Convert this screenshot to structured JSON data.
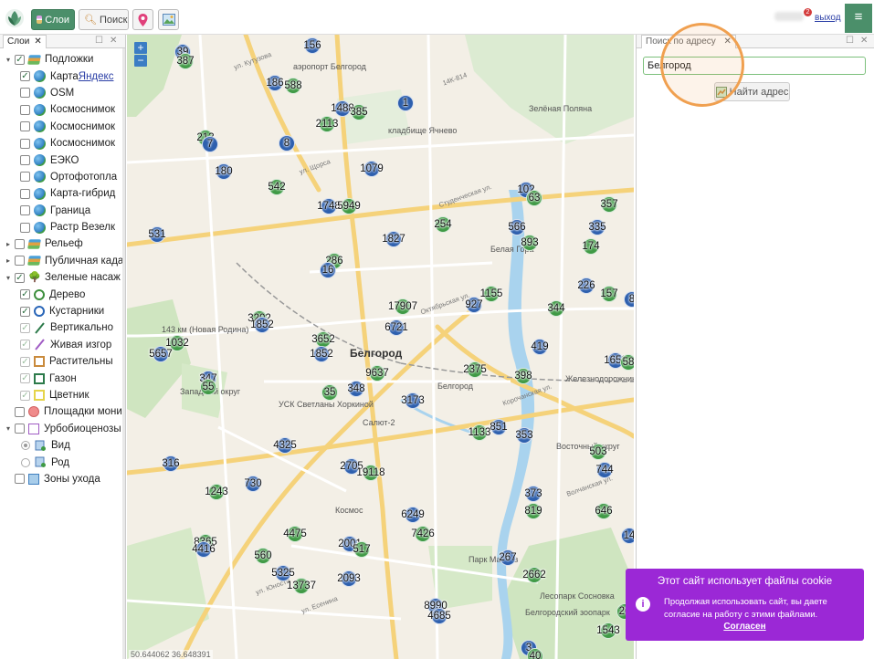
{
  "toolbar": {
    "layers_label": "Слои",
    "search_label": "Поиск",
    "notification_count": "2",
    "logout_label": "выход",
    "menu_glyph": "≡"
  },
  "left_panel": {
    "tab_label": "Слои",
    "tree": [
      {
        "label": "Подложки",
        "level": 0,
        "expander": "▾",
        "check": "checked",
        "icon": "stack"
      },
      {
        "label": "Карта ",
        "link": "Яндекс",
        "level": 1,
        "check": "checked",
        "icon": "globe"
      },
      {
        "label": "OSM",
        "level": 1,
        "check": "unchecked",
        "icon": "globe"
      },
      {
        "label": "Космоснимок",
        "level": 1,
        "check": "unchecked",
        "icon": "globe"
      },
      {
        "label": "Космоснимок",
        "level": 1,
        "check": "unchecked",
        "icon": "globe"
      },
      {
        "label": "Космоснимок",
        "level": 1,
        "check": "unchecked",
        "icon": "globe"
      },
      {
        "label": "ЕЭКО",
        "level": 1,
        "check": "unchecked",
        "icon": "globe"
      },
      {
        "label": "Ортофотопла",
        "level": 1,
        "check": "unchecked",
        "icon": "globe"
      },
      {
        "label": "Карта-гибрид",
        "level": 1,
        "check": "unchecked",
        "icon": "globe"
      },
      {
        "label": "Граница",
        "level": 1,
        "check": "unchecked",
        "icon": "globe"
      },
      {
        "label": "Растр Везелк",
        "level": 1,
        "check": "unchecked",
        "icon": "globe"
      },
      {
        "label": "Рельеф",
        "level": 0,
        "expander": "▸",
        "check": "unchecked",
        "icon": "stack"
      },
      {
        "label": "Публичная када",
        "level": 0,
        "expander": "▸",
        "check": "unchecked",
        "icon": "stack"
      },
      {
        "label": "Зеленые насаж",
        "level": 0,
        "expander": "▾",
        "check": "checked",
        "icon": "tree"
      },
      {
        "label": "Дерево",
        "level": 1,
        "check": "checked",
        "icon": "circ-g"
      },
      {
        "label": "Кустарники",
        "level": 1,
        "check": "checked",
        "icon": "circ-b"
      },
      {
        "label": "Вертикально",
        "level": 1,
        "check": "dim",
        "icon": "line-g"
      },
      {
        "label": "Живая изгор",
        "level": 1,
        "check": "dim",
        "icon": "line-p"
      },
      {
        "label": "Растительны",
        "level": 1,
        "check": "dim",
        "icon": "sq-o"
      },
      {
        "label": "Газон",
        "level": 1,
        "check": "dim",
        "icon": "sq-g"
      },
      {
        "label": "Цветник",
        "level": 1,
        "check": "dim",
        "icon": "sq-y"
      },
      {
        "label": "Площадки мони",
        "level": 0,
        "check": "unchecked",
        "icon": "dot-r"
      },
      {
        "label": "Урбобиоценозы",
        "level": 0,
        "expander": "▾",
        "check": "unchecked",
        "icon": "sq-p"
      },
      {
        "label": "Вид",
        "level": 1,
        "radio": "on",
        "icon": "doc"
      },
      {
        "label": "Род",
        "level": 1,
        "radio": "off",
        "icon": "doc"
      },
      {
        "label": "Зоны ухода",
        "level": 0,
        "check": "unchecked",
        "icon": "sq-b"
      }
    ]
  },
  "map": {
    "zoom_in": "+",
    "zoom_out": "−",
    "coordinates": "50.644062 36.648391",
    "labels": [
      {
        "text": "Белгород",
        "cls": "city"
      },
      {
        "text": "аэропорт Белгород"
      },
      {
        "text": "Зелёная Поляна"
      },
      {
        "text": "Белая Гора"
      },
      {
        "text": "кладбище Ячнево"
      },
      {
        "text": "143 км (Новая Родина)"
      },
      {
        "text": "Белгород"
      },
      {
        "text": "Салют-2"
      },
      {
        "text": "Космос"
      },
      {
        "text": "Восточный округ"
      },
      {
        "text": "Западный округ"
      },
      {
        "text": "Железнодорожник"
      },
      {
        "text": "ул. Щорса",
        "cls": "road"
      },
      {
        "text": "Октябрьская ул.",
        "cls": "road"
      },
      {
        "text": "Студенческая ул.",
        "cls": "road"
      },
      {
        "text": "Белгородский зоопарк"
      },
      {
        "text": "Лесопарк Сосновка"
      },
      {
        "text": "ул. Есенина",
        "cls": "road"
      },
      {
        "text": "ул. Юности",
        "cls": "road"
      },
      {
        "text": "ул. Кутузова",
        "cls": "road"
      },
      {
        "text": "Корочанская ул.",
        "cls": "road"
      },
      {
        "text": "Волчанская ул.",
        "cls": "road"
      },
      {
        "text": "УСК Светланы Хоркиной"
      },
      {
        "text": "Парк Массив"
      },
      {
        "text": "14К-814",
        "cls": "road"
      }
    ],
    "clusters": [
      {
        "n": "39",
        "c": "b"
      },
      {
        "n": "387",
        "c": "g"
      },
      {
        "n": "156",
        "c": "b"
      },
      {
        "n": "186",
        "c": "b"
      },
      {
        "n": "588",
        "c": "g"
      },
      {
        "n": "1",
        "c": "b"
      },
      {
        "n": "1488",
        "c": "b"
      },
      {
        "n": "385",
        "c": "g"
      },
      {
        "n": "2113",
        "c": "g"
      },
      {
        "n": "213",
        "c": "g"
      },
      {
        "n": "7",
        "c": "b"
      },
      {
        "n": "8",
        "c": "b"
      },
      {
        "n": "180",
        "c": "b"
      },
      {
        "n": "1079",
        "c": "b"
      },
      {
        "n": "542",
        "c": "g"
      },
      {
        "n": "102",
        "c": "b"
      },
      {
        "n": "63",
        "c": "g"
      },
      {
        "n": "357",
        "c": "g"
      },
      {
        "n": "1748",
        "c": "b"
      },
      {
        "n": "5949",
        "c": "g"
      },
      {
        "n": "254",
        "c": "g"
      },
      {
        "n": "566",
        "c": "b"
      },
      {
        "n": "335",
        "c": "b"
      },
      {
        "n": "531",
        "c": "b"
      },
      {
        "n": "1827",
        "c": "b"
      },
      {
        "n": "893",
        "c": "g"
      },
      {
        "n": "174",
        "c": "g"
      },
      {
        "n": "286",
        "c": "g"
      },
      {
        "n": "16",
        "c": "b"
      },
      {
        "n": "226",
        "c": "b"
      },
      {
        "n": "157",
        "c": "g"
      },
      {
        "n": "8",
        "c": "b"
      },
      {
        "n": "1155",
        "c": "g"
      },
      {
        "n": "17907",
        "c": "g"
      },
      {
        "n": "927",
        "c": "b"
      },
      {
        "n": "344",
        "c": "g"
      },
      {
        "n": "3202",
        "c": "g"
      },
      {
        "n": "1852",
        "c": "b"
      },
      {
        "n": "6721",
        "c": "b"
      },
      {
        "n": "3652",
        "c": "g"
      },
      {
        "n": "1032",
        "c": "g"
      },
      {
        "n": "5657",
        "c": "b"
      },
      {
        "n": "1852",
        "c": "b"
      },
      {
        "n": "419",
        "c": "b"
      },
      {
        "n": "1659",
        "c": "b"
      },
      {
        "n": "58",
        "c": "g"
      },
      {
        "n": "2375",
        "c": "g"
      },
      {
        "n": "9637",
        "c": "g"
      },
      {
        "n": "398",
        "c": "g"
      },
      {
        "n": "347",
        "c": "b"
      },
      {
        "n": "55",
        "c": "g"
      },
      {
        "n": "35",
        "c": "g"
      },
      {
        "n": "348",
        "c": "b"
      },
      {
        "n": "3173",
        "c": "b"
      },
      {
        "n": "851",
        "c": "b"
      },
      {
        "n": "1133",
        "c": "g"
      },
      {
        "n": "353",
        "c": "b"
      },
      {
        "n": "4325",
        "c": "b"
      },
      {
        "n": "2705",
        "c": "b"
      },
      {
        "n": "19118",
        "c": "g"
      },
      {
        "n": "503",
        "c": "g"
      },
      {
        "n": "316",
        "c": "b"
      },
      {
        "n": "744",
        "c": "b"
      },
      {
        "n": "730",
        "c": "b"
      },
      {
        "n": "1243",
        "c": "g"
      },
      {
        "n": "373",
        "c": "b"
      },
      {
        "n": "819",
        "c": "g"
      },
      {
        "n": "646",
        "c": "g"
      },
      {
        "n": "6249",
        "c": "b"
      },
      {
        "n": "4475",
        "c": "g"
      },
      {
        "n": "7426",
        "c": "g"
      },
      {
        "n": "8365",
        "c": "g"
      },
      {
        "n": "4416",
        "c": "b"
      },
      {
        "n": "2001",
        "c": "b"
      },
      {
        "n": "517",
        "c": "g"
      },
      {
        "n": "560",
        "c": "g"
      },
      {
        "n": "267",
        "c": "b"
      },
      {
        "n": "14",
        "c": "b"
      },
      {
        "n": "5325",
        "c": "b"
      },
      {
        "n": "2662",
        "c": "g"
      },
      {
        "n": "13737",
        "c": "g"
      },
      {
        "n": "2093",
        "c": "b"
      },
      {
        "n": "8990",
        "c": "b"
      },
      {
        "n": "4685",
        "c": "b"
      },
      {
        "n": "26",
        "c": "g"
      },
      {
        "n": "1543",
        "c": "g"
      },
      {
        "n": "3",
        "c": "b"
      },
      {
        "n": "40",
        "c": "g"
      }
    ]
  },
  "right_panel": {
    "tab_label": "Поиск по адресу",
    "address_value": "Белгород",
    "find_button_label": "Найти адрес"
  },
  "cookie": {
    "title": "Этот сайт использует файлы cookie",
    "icon": "i",
    "text": "Продолжая использовать сайт, вы даете согласие на работу с этими файлами.",
    "accept_label": "Согласен"
  },
  "colors": {
    "accent": "#4b8f6a",
    "cluster_blue": "#2d5fae",
    "cluster_green": "#3f9a45",
    "cookie": "#9b28d6",
    "highlight": "#f0a050"
  }
}
